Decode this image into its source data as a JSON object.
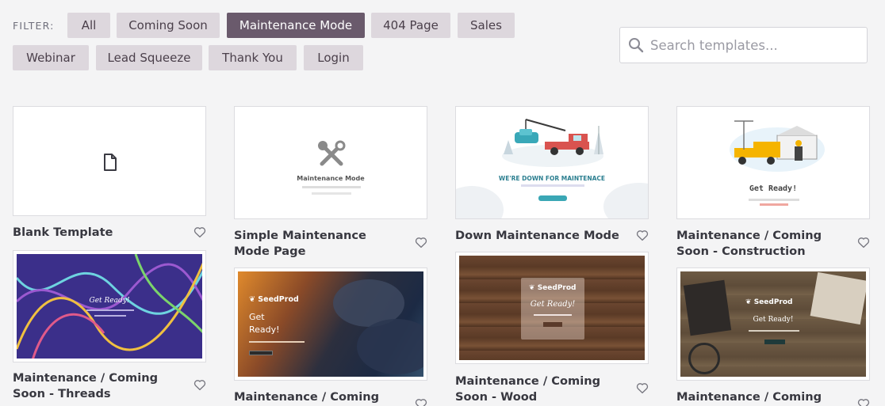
{
  "filter": {
    "label": "FILTER:",
    "buttons": [
      {
        "label": "All",
        "active": false
      },
      {
        "label": "Coming Soon",
        "active": false
      },
      {
        "label": "Maintenance Mode",
        "active": true
      },
      {
        "label": "404 Page",
        "active": false
      },
      {
        "label": "Sales",
        "active": false
      },
      {
        "label": "Webinar",
        "active": false
      },
      {
        "label": "Lead Squeeze",
        "active": false
      },
      {
        "label": "Thank You",
        "active": false
      },
      {
        "label": "Login",
        "active": false
      }
    ]
  },
  "search": {
    "placeholder": "Search templates..."
  },
  "templates": [
    {
      "title": "Blank Template",
      "thumb": {}
    },
    {
      "title": "Simple Maintenance Mode Page",
      "thumb": {
        "heading": "Maintenance Mode"
      }
    },
    {
      "title": "Down Maintenance Mode",
      "thumb": {
        "heading": "WE'RE DOWN FOR MAINTENACE"
      }
    },
    {
      "title": "Maintenance / Coming Soon - Construction",
      "thumb": {
        "heading": "Get Ready!"
      }
    },
    {
      "title": "Maintenance / Coming Soon - Threads",
      "thumb": {
        "heading": "Get Ready!"
      }
    },
    {
      "title": "Maintenance / Coming Soon -",
      "thumb": {
        "brand": "SeedProd",
        "heading": "Get Ready!"
      }
    },
    {
      "title": "Maintenance / Coming Soon - Wood",
      "thumb": {
        "brand": "SeedProd",
        "heading": "Get Ready!"
      }
    },
    {
      "title": "Maintenance / Coming Soon -",
      "thumb": {
        "brand": "SeedProd",
        "heading": "Get Ready!"
      }
    }
  ],
  "colors": {
    "accent": "#6a5a6c",
    "chip": "#ddd7dd",
    "background": "#f4f4f5"
  },
  "icons": {
    "search": "magnifier-icon",
    "favorite": "heart-outline-icon",
    "blank": "document-icon"
  }
}
